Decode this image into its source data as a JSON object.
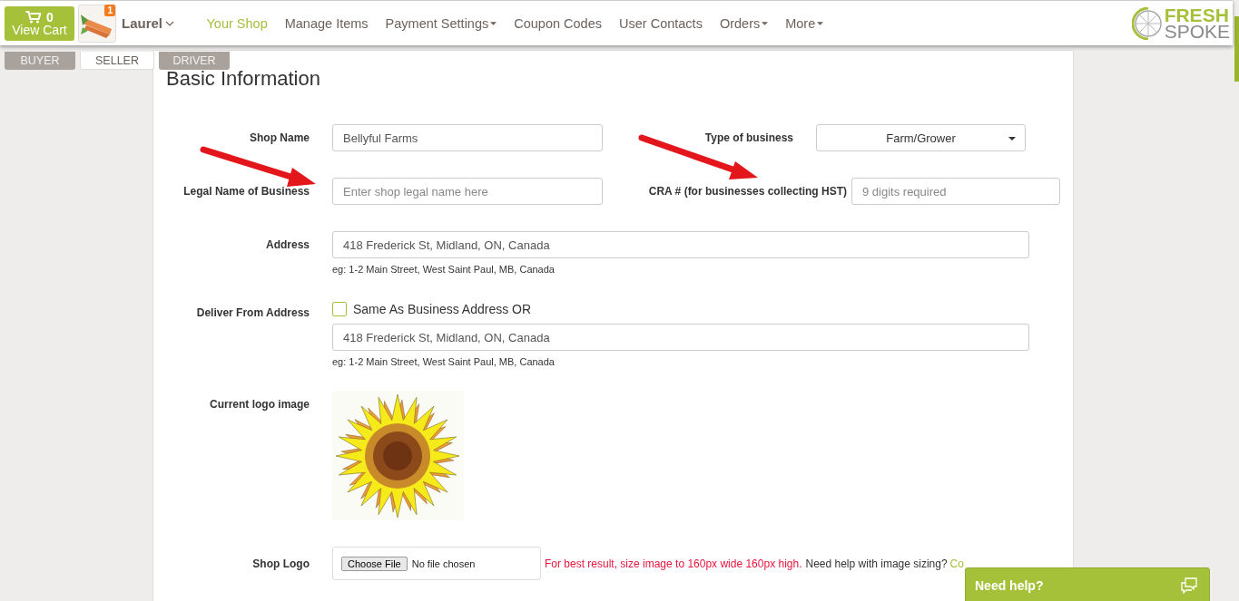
{
  "nav": {
    "cart": {
      "count": "0",
      "label": "View Cart"
    },
    "user": {
      "badge": "1",
      "name": "Laurel"
    },
    "links": [
      {
        "label": "Your Shop",
        "selected": true,
        "dropdown": false
      },
      {
        "label": "Manage Items",
        "selected": false,
        "dropdown": false
      },
      {
        "label": "Payment Settings",
        "selected": false,
        "dropdown": true
      },
      {
        "label": "Coupon Codes",
        "selected": false,
        "dropdown": false
      },
      {
        "label": "User Contacts",
        "selected": false,
        "dropdown": false
      },
      {
        "label": "Orders",
        "selected": false,
        "dropdown": true
      },
      {
        "label": "More",
        "selected": false,
        "dropdown": true
      }
    ],
    "logo": {
      "line1": "FRESH",
      "line2": "SPOKE"
    }
  },
  "role_tabs": [
    {
      "label": "BUYER",
      "selected": false
    },
    {
      "label": "SELLER",
      "selected": true
    },
    {
      "label": "DRIVER",
      "selected": false
    }
  ],
  "section_title": "Basic Information",
  "form": {
    "shop_name": {
      "label": "Shop Name",
      "value": "Bellyful Farms"
    },
    "type_of_business": {
      "label": "Type of business",
      "value": "Farm/Grower"
    },
    "legal_name": {
      "label": "Legal Name of Business",
      "placeholder": "Enter shop legal name here"
    },
    "cra": {
      "label": "CRA # (for businesses collecting HST)",
      "placeholder": "9 digits required"
    },
    "address": {
      "label": "Address",
      "value": "418 Frederick St, Midland, ON, Canada",
      "hint": "eg: 1-2 Main Street, West Saint Paul, MB, Canada"
    },
    "deliver_from": {
      "label": "Deliver From Address",
      "checkbox": {
        "label": "Same As Business Address OR",
        "checked": false
      },
      "value": "418 Frederick St, Midland, ON, Canada",
      "hint": "eg: 1-2 Main Street, West Saint Paul, MB, Canada"
    },
    "logo_image": {
      "label": "Current logo image"
    },
    "shop_logo": {
      "label": "Shop Logo",
      "button": "Choose File",
      "status": "No file chosen",
      "warning": "For best result, size image to 160px wide 160px high.",
      "help": "Need help with image sizing?",
      "link": "Co"
    }
  },
  "help_widget": {
    "label": "Need help?"
  }
}
